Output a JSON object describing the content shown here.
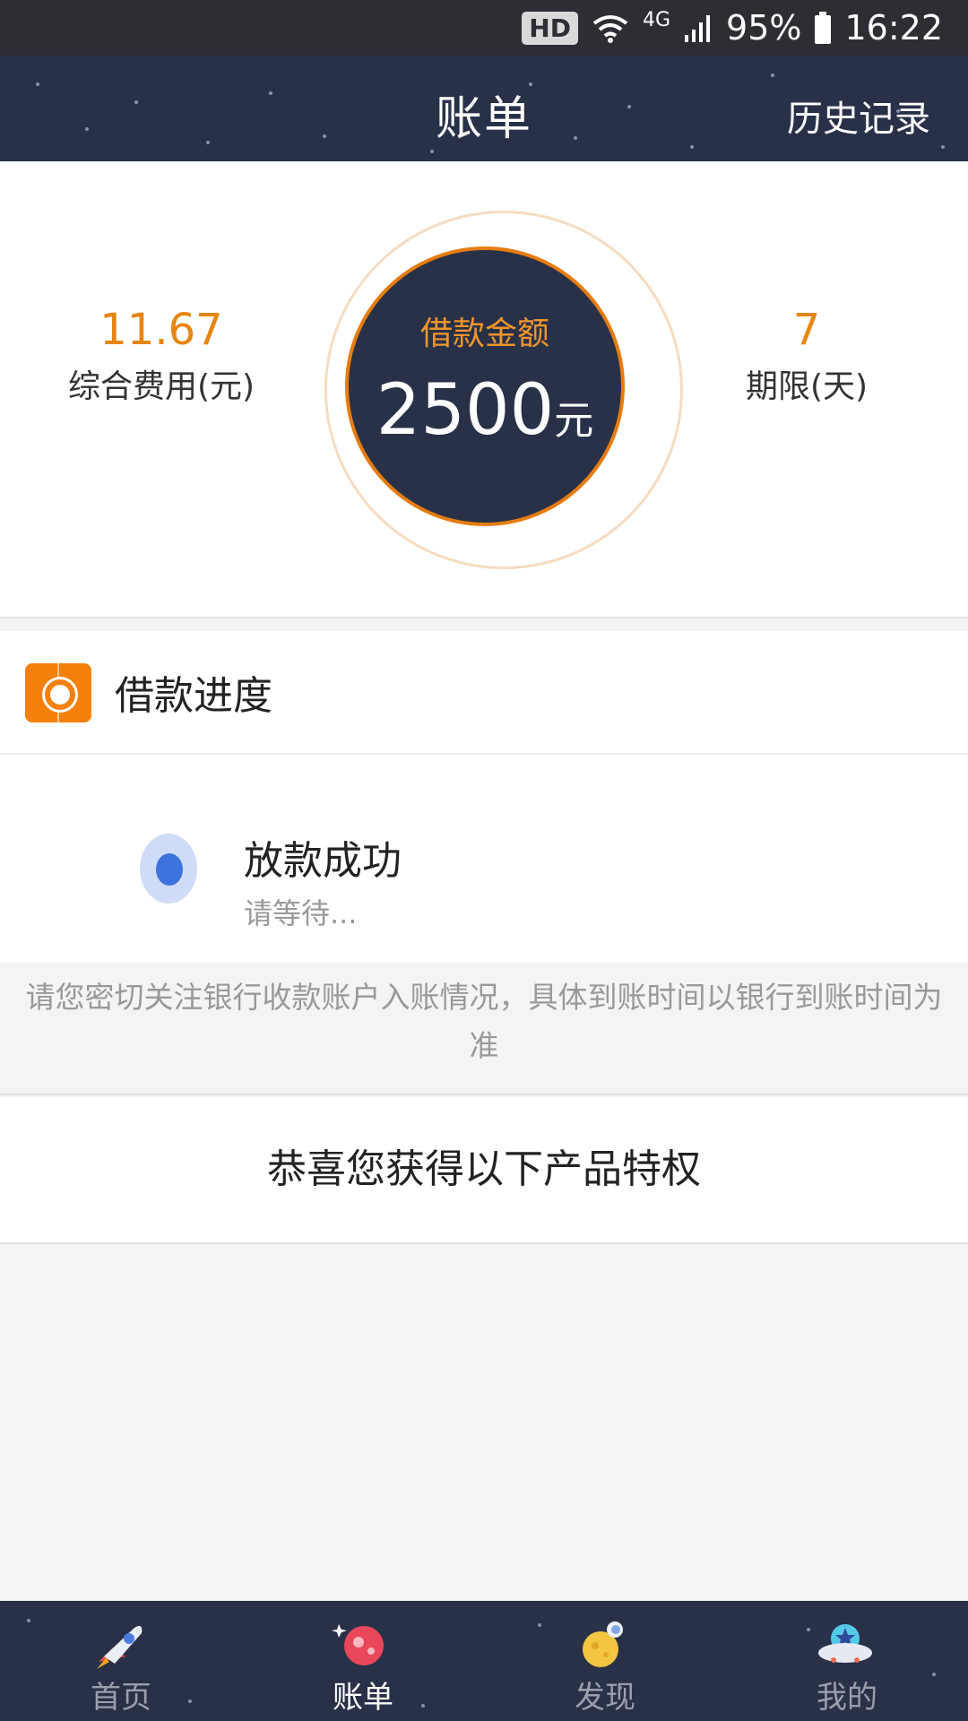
{
  "status_bar": {
    "badge": "HD",
    "network": "4G",
    "battery": "95%",
    "time": "16:22"
  },
  "header": {
    "title": "账单",
    "history_link": "历史记录"
  },
  "summary": {
    "fee_value": "11.67",
    "fee_label": "综合费用(元)",
    "loan_label": "借款金额",
    "loan_amount": "2500",
    "loan_unit": "元",
    "term_value": "7",
    "term_label": "期限(天)"
  },
  "progress": {
    "section_title": "借款进度",
    "step_title": "放款成功",
    "step_subtitle": "请等待...",
    "notice": "请您密切关注银行收款账户入账情况，具体到账时间以银行到账时间为准"
  },
  "privilege": {
    "title": "恭喜您获得以下产品特权"
  },
  "bottom_nav": {
    "items": [
      {
        "label": "首页",
        "icon": "rocket-icon",
        "active": false
      },
      {
        "label": "账单",
        "icon": "bill-planet-icon",
        "active": true
      },
      {
        "label": "发现",
        "icon": "moon-astronaut-icon",
        "active": false
      },
      {
        "label": "我的",
        "icon": "ufo-icon",
        "active": false
      }
    ]
  },
  "colors": {
    "navy": "#283148",
    "orange": "#e68612",
    "blue_dot": "#3e72de"
  }
}
